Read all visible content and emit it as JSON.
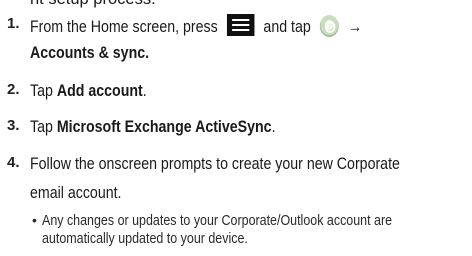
{
  "top_fragment": "nt setup process.",
  "steps": [
    {
      "number": "1.",
      "line1_prefix": "From the Home screen, press",
      "line1_mid": "and tap",
      "line1_arrow": "→",
      "line2_bold": "Accounts & sync."
    },
    {
      "number": "2.",
      "prefix": "Tap ",
      "bold": "Add account",
      "suffix": "."
    },
    {
      "number": "3.",
      "prefix": "Tap ",
      "bold": "Microsoft Exchange ActiveSync",
      "suffix": "."
    },
    {
      "number": "4.",
      "line1": "Follow the onscreen prompts to create your new Corporate",
      "line2": "email account."
    }
  ],
  "bullet": {
    "glyph": "•",
    "line1": "Any changes or updates to your Corporate/Outlook account are",
    "line2": "automatically updated to your device."
  },
  "icons": {
    "menu": "menu-key-icon",
    "settings": "settings-gear-icon"
  }
}
